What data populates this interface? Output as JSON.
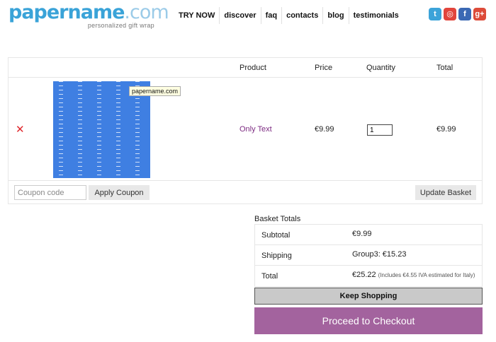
{
  "header": {
    "logo_bold": "papername",
    "logo_light": ".com",
    "tagline": "personalized gift wrap",
    "nav": [
      "TRY NOW",
      "discover",
      "faq",
      "contacts",
      "blog",
      "testimonials"
    ],
    "social": [
      {
        "icon": "twitter-icon",
        "glyph": "t",
        "color": "#3ca3d9"
      },
      {
        "icon": "instagram-icon",
        "glyph": "◎",
        "color": "#e2453c"
      },
      {
        "icon": "facebook-icon",
        "glyph": "f",
        "color": "#3b69b4"
      },
      {
        "icon": "google-plus-icon",
        "glyph": "g+",
        "color": "#dd4b39"
      }
    ]
  },
  "cart": {
    "columns": {
      "product": "Product",
      "price": "Price",
      "quantity": "Quantity",
      "total": "Total"
    },
    "item": {
      "remove_glyph": "✕",
      "thumbnail_tooltip": "papername.com",
      "product_name": "Only Text",
      "price": "€9.99",
      "quantity": "1",
      "total": "€9.99"
    },
    "coupon_placeholder": "Coupon code",
    "apply_label": "Apply Coupon",
    "update_label": "Update Basket"
  },
  "totals": {
    "title": "Basket Totals",
    "subtotal_label": "Subtotal",
    "subtotal_value": "€9.99",
    "shipping_label": "Shipping",
    "shipping_value": "Group3: €15.23",
    "total_label": "Total",
    "total_value": "€25.22",
    "total_note": "(Includes €4.55 IVA estimated for Italy)"
  },
  "actions": {
    "keep_shopping": "Keep Shopping",
    "checkout": "Proceed to Checkout"
  }
}
